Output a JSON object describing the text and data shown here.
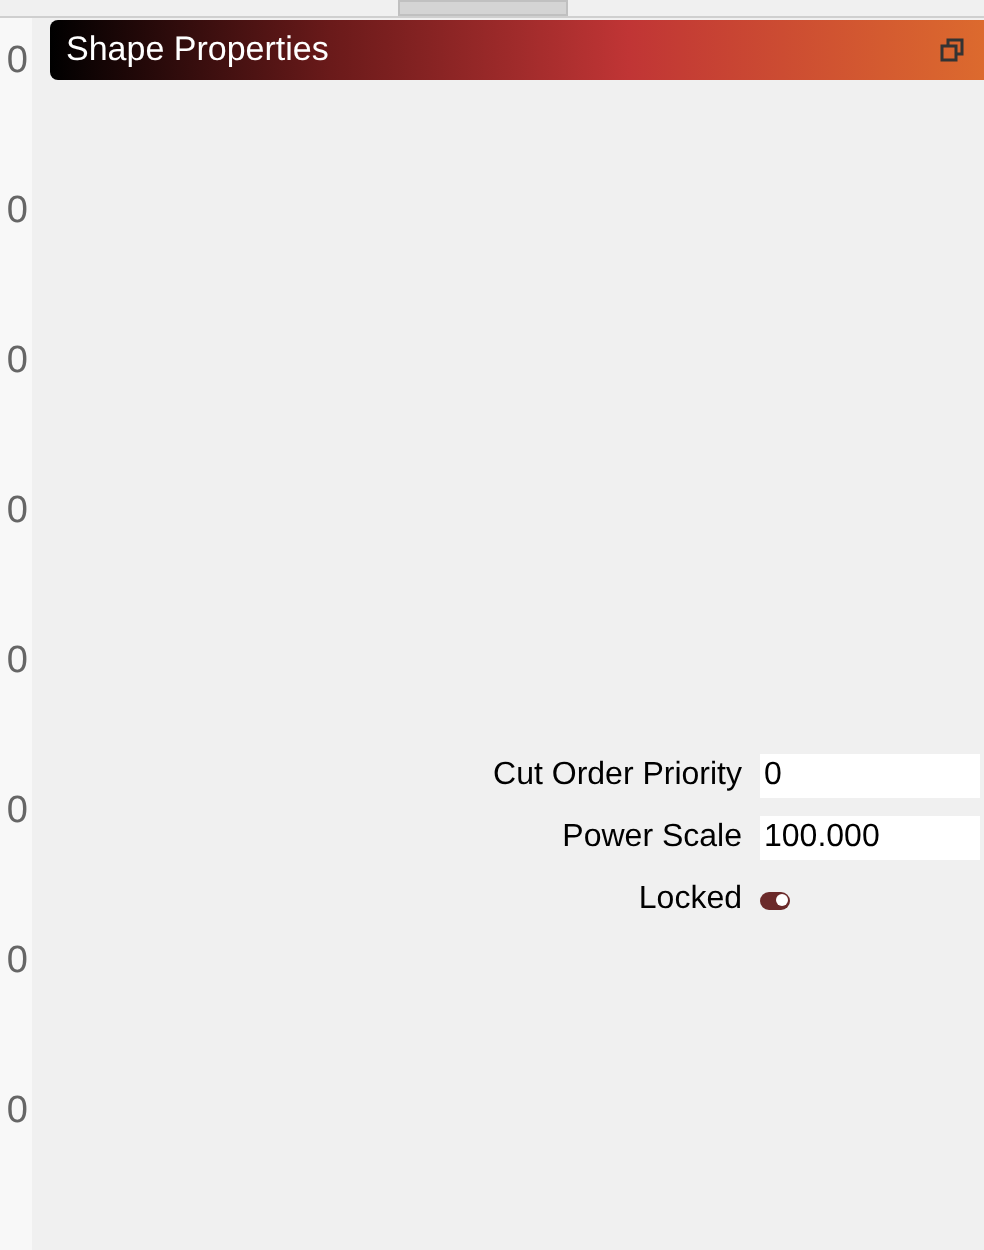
{
  "ruler": {
    "labels": [
      "0",
      "0",
      "0",
      "0",
      "0",
      "0",
      "0",
      "0"
    ]
  },
  "panel": {
    "title": "Shape Properties",
    "fields": [
      {
        "kind": "number",
        "label": "Cut Order Priority",
        "value": "0"
      },
      {
        "kind": "number",
        "label": "Power Scale",
        "value": "100.000"
      },
      {
        "kind": "toggle",
        "label": "Locked",
        "on": true
      }
    ]
  }
}
